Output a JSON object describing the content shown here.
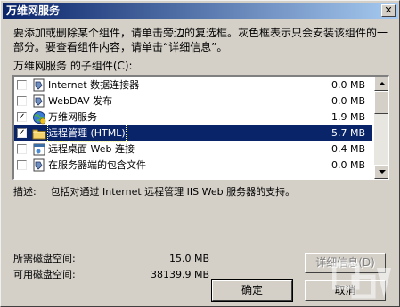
{
  "window": {
    "title": "万维网服务",
    "close_glyph": "✕"
  },
  "intro_text": "要添加或删除某个组件，请单击旁边的复选框。灰色框表示只会安装该组件的一部分。要查看组件内容，请单击“详细信息”。",
  "list_label": "万维网服务 的子组件(C):",
  "components": [
    {
      "name": "Internet 数据连接器",
      "size": "0.0 MB",
      "checked": false,
      "icon": "component-icon"
    },
    {
      "name": "WebDAV 发布",
      "size": "0.0 MB",
      "checked": false,
      "icon": "component-icon"
    },
    {
      "name": "万维网服务",
      "size": "1.9 MB",
      "checked": true,
      "icon": "globe-icon"
    },
    {
      "name": "远程管理 (HTML)",
      "size": "5.7 MB",
      "checked": true,
      "icon": "folder-icon",
      "selected": true
    },
    {
      "name": "远程桌面 Web 连接",
      "size": "0.4 MB",
      "checked": false,
      "icon": "web-page-icon"
    },
    {
      "name": "在服务器端的包含文件",
      "size": "0.0 MB",
      "checked": false,
      "icon": "component-icon"
    }
  ],
  "description": {
    "label": "描述:",
    "text": "包括对通过 Internet 远程管理 IIS Web 服务器的支持。"
  },
  "disk_space": {
    "required_label": "所需磁盘空间:",
    "required_value": "15.0 MB",
    "available_label": "可用磁盘空间:",
    "available_value": "38139.9 MB"
  },
  "buttons": {
    "details": "详细信息(D)",
    "ok": "确定",
    "cancel": "取消"
  },
  "colors": {
    "selection": "#0a246a",
    "dialog_bg": "#d4d0c8"
  }
}
